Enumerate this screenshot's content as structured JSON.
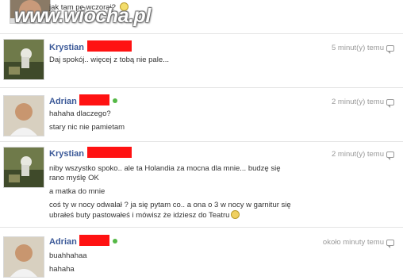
{
  "watermark": "www.wiocha.pl",
  "top_message": {
    "text": "jak tam po wczoraj? ",
    "emoji": "smile-icon"
  },
  "messages": [
    {
      "author": "Krystian",
      "online": false,
      "time": "5 minut(y) temu",
      "lines": [
        "Daj spokój.. więcej z tobą nie pale..."
      ]
    },
    {
      "author": "Adrian",
      "online": true,
      "time": "2 minut(y) temu",
      "lines": [
        "hahaha dlaczego?",
        "stary nic nie pamietam"
      ]
    },
    {
      "author": "Krystian",
      "online": false,
      "time": "2 minut(y) temu",
      "lines": [
        "niby wszystko spoko.. ale ta Holandia za mocna dla mnie... budzę się",
        "rano myślę OK",
        "a matka do mnie",
        "coś ty w nocy odwalał ? ja się pytam co.. a ona o 3 w nocy w garnitur się",
        "ubrałeś buty pastowałeś i mówisz że idziesz do Teatru"
      ]
    },
    {
      "author": "Adrian",
      "online": true,
      "time": "około minuty temu",
      "lines": [
        "buahhahaa",
        "hahaha"
      ]
    }
  ],
  "colors": {
    "name": "#3b5998",
    "redaction": "#ff1212",
    "online": "#55b846",
    "meta": "#9a9a9a"
  },
  "icons": {
    "reply": "reply-icon",
    "online": "online-dot-icon",
    "embarrassed": "embarrassed-smiley-icon"
  }
}
